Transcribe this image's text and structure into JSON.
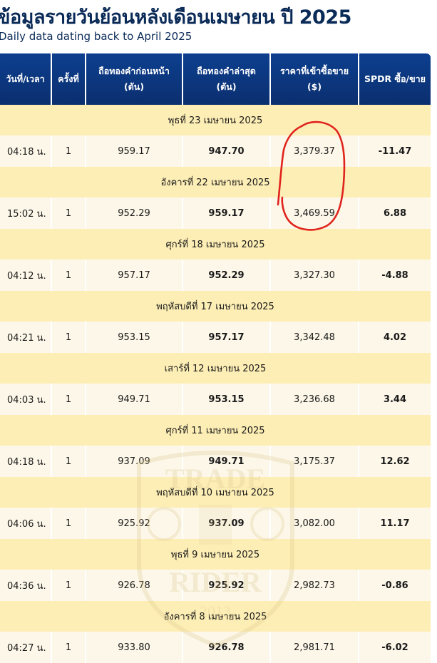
{
  "page": {
    "title": "ข้อมูลรายวันย้อนหลังเดือนเมษายน ปี 2025",
    "subtitle": "Daily data dating back to April 2025"
  },
  "table": {
    "headers": [
      "วันที่/เวลา",
      "ครั้งที่",
      "ถือทองคำก่อนหน้า (ตัน)",
      "ถือทองคำล่าสุด (ตัน)",
      "ราคาที่เข้าซื้อขาย ($)",
      "SPDR ซื้อ/ขาย"
    ],
    "groups": [
      {
        "date": "พุธที่ 23 เมษายน 2025",
        "time": "04:18 น.",
        "count": "1",
        "prev": "959.17",
        "latest": "947.70",
        "price": "3,379.37",
        "change": "-11.47",
        "trend": "down"
      },
      {
        "date": "อังคารที่ 22 เมษายน 2025",
        "time": "15:02 น.",
        "count": "1",
        "prev": "952.29",
        "latest": "959.17",
        "price": "3,469.59",
        "change": "6.88",
        "trend": "up"
      },
      {
        "date": "ศุกร์ที่ 18 เมษายน 2025",
        "time": "04:12 น.",
        "count": "1",
        "prev": "957.17",
        "latest": "952.29",
        "price": "3,327.30",
        "change": "-4.88",
        "trend": "down"
      },
      {
        "date": "พฤหัสบดีที่ 17 เมษายน 2025",
        "time": "04:21 น.",
        "count": "1",
        "prev": "953.15",
        "latest": "957.17",
        "price": "3,342.48",
        "change": "4.02",
        "trend": "up"
      },
      {
        "date": "เสาร์ที่ 12 เมษายน 2025",
        "time": "04:03 น.",
        "count": "1",
        "prev": "949.71",
        "latest": "953.15",
        "price": "3,236.68",
        "change": "3.44",
        "trend": "up"
      },
      {
        "date": "ศุกร์ที่ 11 เมษายน 2025",
        "time": "04:18 น.",
        "count": "1",
        "prev": "937.09",
        "latest": "949.71",
        "price": "3,175.37",
        "change": "12.62",
        "trend": "up"
      },
      {
        "date": "พฤหัสบดีที่ 10 เมษายน 2025",
        "time": "04:06 น.",
        "count": "1",
        "prev": "925.92",
        "latest": "937.09",
        "price": "3,082.00",
        "change": "11.17",
        "trend": "up"
      },
      {
        "date": "พุธที่ 9 เมษายน 2025",
        "time": "04:36 น.",
        "count": "1",
        "prev": "926.78",
        "latest": "925.92",
        "price": "2,982.73",
        "change": "-0.86",
        "trend": "down"
      },
      {
        "date": "อังคารที่ 8 เมษายน 2025",
        "time": "04:27 น.",
        "count": "1",
        "prev": "933.80",
        "latest": "926.78",
        "price": "2,981.71",
        "change": "-6.02",
        "trend": "down"
      }
    ]
  },
  "watermark": {
    "top_text": "TRADE",
    "bottom_text": "RIDER",
    "year": "2013",
    "color": "#d8c48a"
  },
  "colors": {
    "header_bg": "#0b3578",
    "date_row_bg": "#fdeeb5",
    "data_row_bg": "#fcf7e8",
    "negative": "#e0121b",
    "positive": "#1b7d17",
    "annotation": "#e0241d"
  }
}
